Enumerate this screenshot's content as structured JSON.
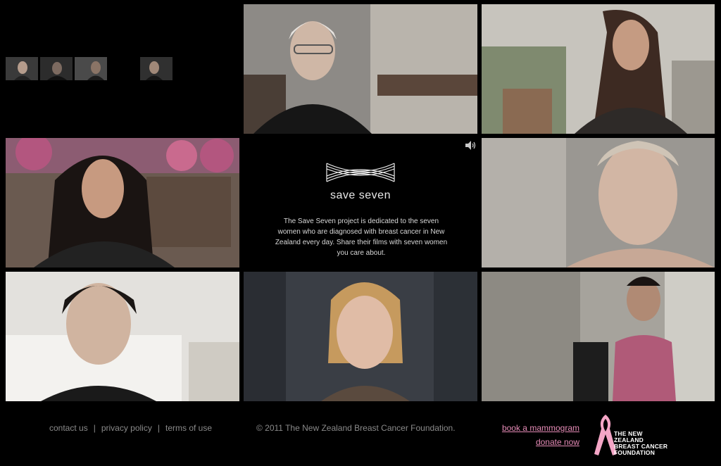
{
  "colors": {
    "background": "#000000",
    "link_pink": "#e58bb6",
    "footer_gray": "#8a8a8a",
    "ribbon_pink": "#f4a6c6"
  },
  "icons": {
    "sound": "speaker-volume-icon",
    "logo": "save-seven-ribbon-logo",
    "foundation": "pink-ribbon-icon"
  },
  "hero": {
    "brand": "save seven",
    "description": "The Save Seven project is dedicated to the seven women who are diagnosed with breast cancer in New Zealand every day. Share their films with seven women you care about."
  },
  "footer": {
    "links": [
      "contact us",
      "privacy policy",
      "terms of use"
    ],
    "separator": "|",
    "copyright": "© 2011 The New Zealand Breast Cancer Foundation.",
    "book_mammogram": "book a mammogram",
    "donate_now": "donate now",
    "foundation_name": [
      "THE NEW ZEALAND",
      "BREAST CANCER",
      "FOUNDATION"
    ]
  }
}
